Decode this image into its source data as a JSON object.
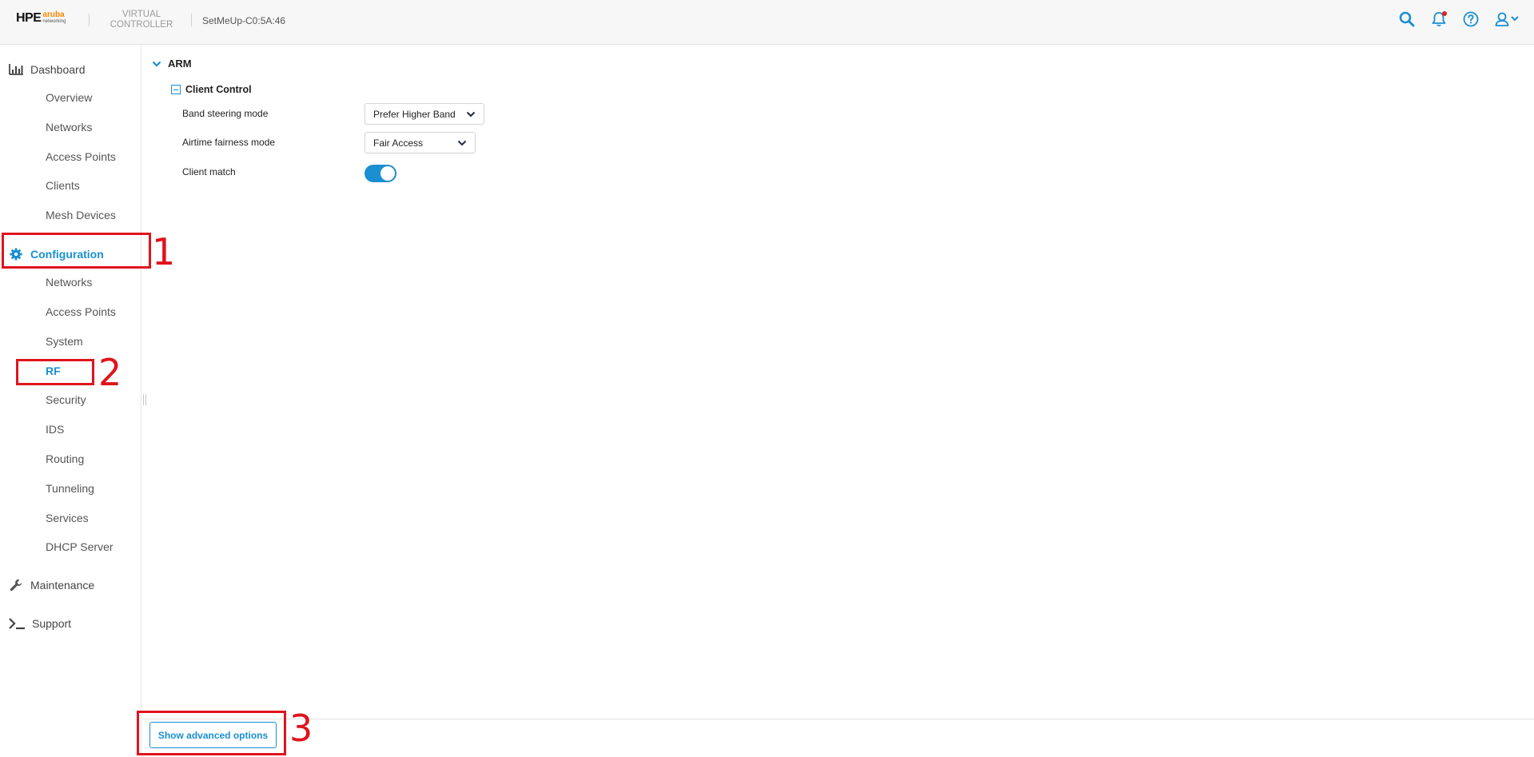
{
  "header": {
    "brand_hpe": "HPE",
    "brand_aruba": "aruba",
    "brand_networking": "networking",
    "product_line1": "VIRTUAL",
    "product_line2": "CONTROLLER",
    "hostname": "SetMeUp-C0:5A:46",
    "icons": [
      "search-icon",
      "bell-icon",
      "help-icon",
      "user-icon"
    ],
    "accent_color": "#1a8fd1",
    "notification_dot_color": "#e02020"
  },
  "sidebar": {
    "dashboard": {
      "label": "Dashboard",
      "icon": "bar-chart-icon",
      "items": [
        "Overview",
        "Networks",
        "Access Points",
        "Clients",
        "Mesh Devices"
      ]
    },
    "configuration": {
      "label": "Configuration",
      "icon": "gear-icon",
      "active": true,
      "items": [
        "Networks",
        "Access Points",
        "System",
        "RF",
        "Security",
        "IDS",
        "Routing",
        "Tunneling",
        "Services",
        "DHCP Server"
      ],
      "active_item": "RF"
    },
    "maintenance": {
      "label": "Maintenance",
      "icon": "wrench-icon"
    },
    "support": {
      "label": "Support",
      "icon": "terminal-icon"
    }
  },
  "main": {
    "section_title": "ARM",
    "group_title": "Client Control",
    "fields": {
      "band_steering": {
        "label": "Band steering mode",
        "value": "Prefer Higher Band"
      },
      "airtime_fairness": {
        "label": "Airtime fairness mode",
        "value": "Fair Access"
      },
      "client_match": {
        "label": "Client match",
        "enabled": true
      }
    }
  },
  "footer": {
    "advanced_button": "Show advanced options"
  },
  "annotations": {
    "color": "#e0141c",
    "labels": [
      "1",
      "2",
      "3"
    ]
  }
}
